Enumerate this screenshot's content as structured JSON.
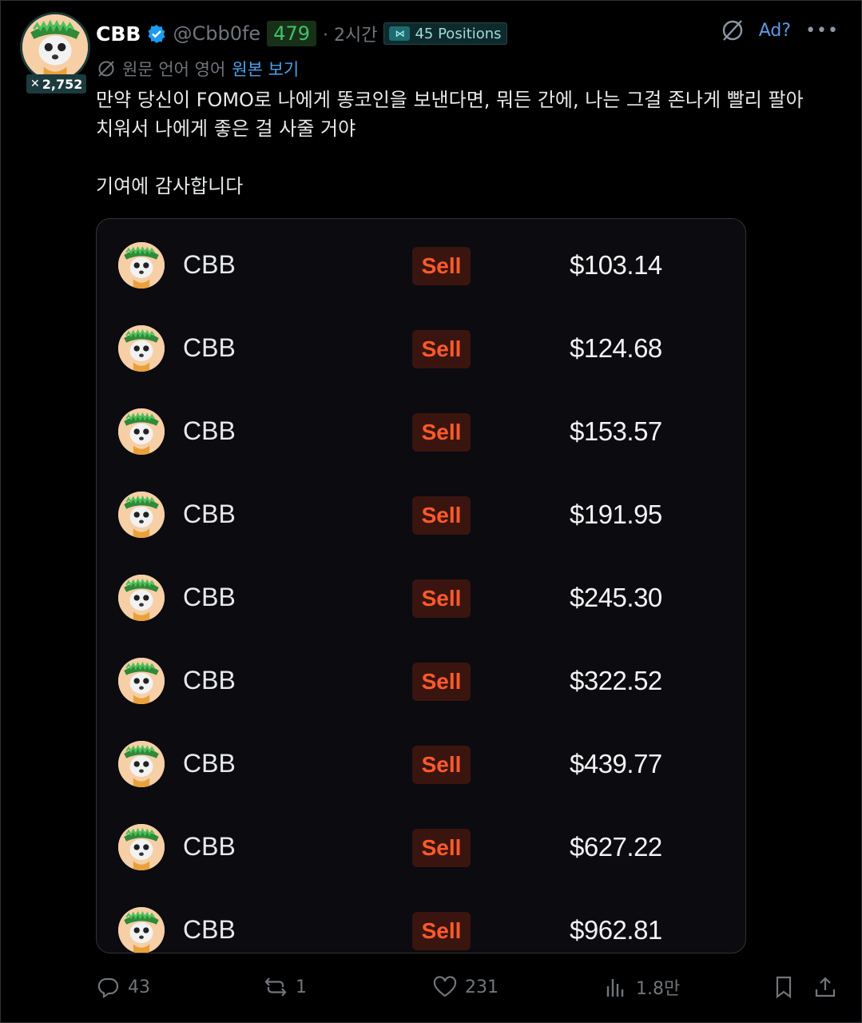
{
  "post": {
    "author_name": "CBB",
    "author_handle": "@Cbb0fe",
    "score": "479",
    "time": "· 2시간",
    "positions_label": "45 Positions",
    "follower_count": "2,752",
    "ad_label": "Ad?",
    "translated_from": "원문 언어 영어",
    "show_original": "원본 보기",
    "text_line1": "만약 당신이 FOMO로 나에게 똥코인을 보낸다면, 뭐든 간에, 나는 그걸 존나게 빨리 팔아",
    "text_line2": "치워서 나에게 좋은 걸 사줄 거야",
    "text_line3": "기여에 감사합니다"
  },
  "card": {
    "rows": [
      {
        "coin": "CBB",
        "action": "Sell",
        "amount": "$103.14"
      },
      {
        "coin": "CBB",
        "action": "Sell",
        "amount": "$124.68"
      },
      {
        "coin": "CBB",
        "action": "Sell",
        "amount": "$153.57"
      },
      {
        "coin": "CBB",
        "action": "Sell",
        "amount": "$191.95"
      },
      {
        "coin": "CBB",
        "action": "Sell",
        "amount": "$245.30"
      },
      {
        "coin": "CBB",
        "action": "Sell",
        "amount": "$322.52"
      },
      {
        "coin": "CBB",
        "action": "Sell",
        "amount": "$439.77"
      },
      {
        "coin": "CBB",
        "action": "Sell",
        "amount": "$627.22"
      },
      {
        "coin": "CBB",
        "action": "Sell",
        "amount": "$962.81"
      }
    ]
  },
  "actions": {
    "replies": "43",
    "reposts": "1",
    "likes": "231",
    "views": "1.8만"
  },
  "colors": {
    "sell_text": "#ff5a2a",
    "sell_bg": "#3a1510",
    "score_green": "#3ec26a",
    "link_blue": "#4aa3f0"
  }
}
